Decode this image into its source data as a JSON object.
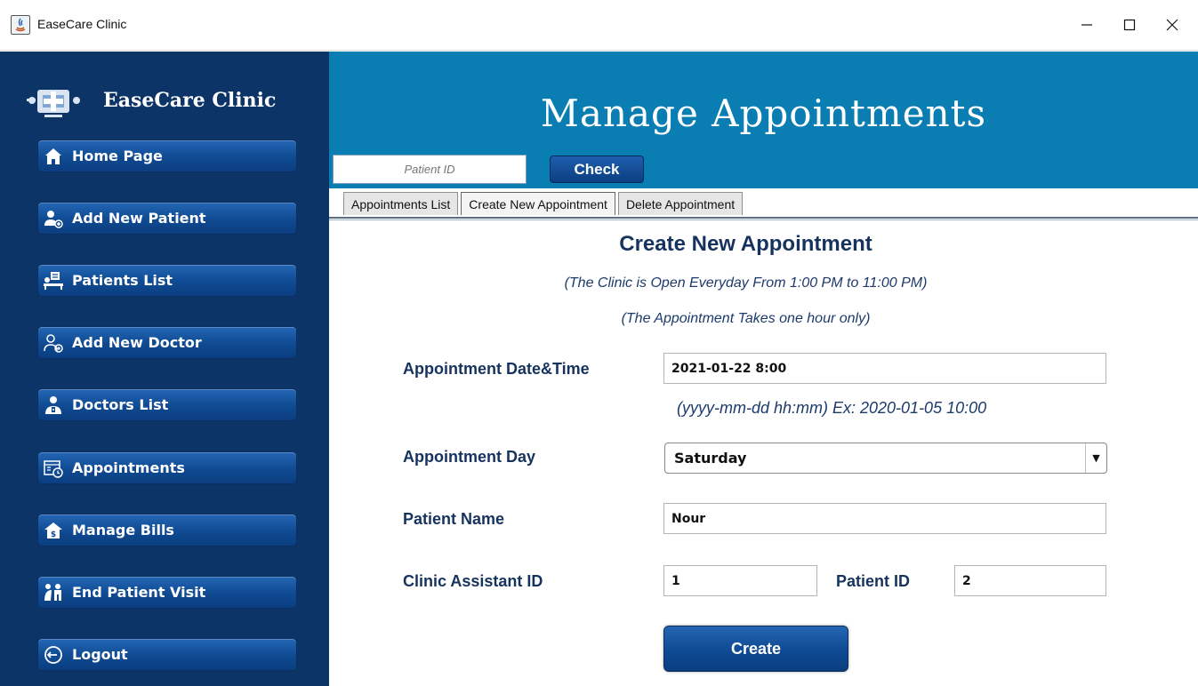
{
  "window": {
    "title": "EaseCare Clinic"
  },
  "sidebar": {
    "brand": "EaseCare Clinic",
    "items": [
      {
        "label": "Home Page",
        "icon": "home-icon"
      },
      {
        "label": "Add New Patient",
        "icon": "add-patient-icon"
      },
      {
        "label": "Patients List",
        "icon": "patients-list-icon"
      },
      {
        "label": "Add New Doctor",
        "icon": "add-doctor-icon"
      },
      {
        "label": "Doctors List",
        "icon": "doctors-list-icon"
      },
      {
        "label": "Appointments",
        "icon": "appointments-icon"
      },
      {
        "label": "Manage Bills",
        "icon": "bills-icon"
      },
      {
        "label": "End Patient Visit",
        "icon": "end-visit-icon"
      },
      {
        "label": "Logout",
        "icon": "logout-icon"
      }
    ]
  },
  "header": {
    "title": "Manage Appointments",
    "patient_id_placeholder": "Patient ID",
    "check_label": "Check"
  },
  "tabs": [
    {
      "label": "Appointments List",
      "active": false
    },
    {
      "label": "Create New Appointment",
      "active": true
    },
    {
      "label": "Delete Appointment",
      "active": false
    }
  ],
  "form": {
    "title": "Create New Appointment",
    "note1": "(The Clinic is Open Everyday From 1:00 PM to 11:00 PM)",
    "note2": "(The Appointment Takes one hour only)",
    "datetime_label": "Appointment Date&Time",
    "datetime_value": "2021-01-22 8:00",
    "datetime_hint": "(yyyy-mm-dd hh:mm) Ex: 2020-01-05 10:00",
    "day_label": "Appointment Day",
    "day_value": "Saturday",
    "patient_name_label": "Patient Name",
    "patient_name_value": "Nour",
    "assistant_id_label": "Clinic Assistant ID",
    "assistant_id_value": "1",
    "patient_id_label": "Patient ID",
    "patient_id_value": "2",
    "create_label": "Create"
  },
  "colors": {
    "sidebar": "#0d3466",
    "header": "#0a7db3",
    "button": "#0f4a92",
    "text_dark": "#16335e"
  }
}
